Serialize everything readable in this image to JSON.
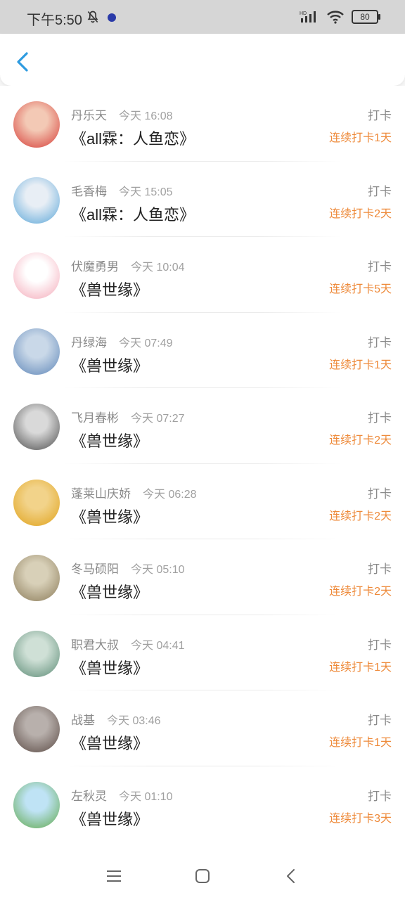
{
  "status_bar": {
    "time": "下午5:50",
    "battery": "80",
    "hd": "HD"
  },
  "header": {
    "back_icon": "chevron-left-icon"
  },
  "records": [
    {
      "name": "丹乐天",
      "time": "今天 16:08",
      "book": "《all霖：人鱼恋》",
      "action": "打卡",
      "streak": "连续打卡1天",
      "avatar_colors": [
        "#d63b36",
        "#f3c9b5"
      ]
    },
    {
      "name": "毛香梅",
      "time": "今天 15:05",
      "book": "《all霖：人鱼恋》",
      "action": "打卡",
      "streak": "连续打卡2天",
      "avatar_colors": [
        "#5aa6d8",
        "#e8eef5"
      ]
    },
    {
      "name": "伏魔勇男",
      "time": "今天 10:04",
      "book": "《兽世缘》",
      "action": "打卡",
      "streak": "连续打卡5天",
      "avatar_colors": [
        "#f4a9b8",
        "#ffffff"
      ]
    },
    {
      "name": "丹绿海",
      "time": "今天 07:49",
      "book": "《兽世缘》",
      "action": "打卡",
      "streak": "连续打卡1天",
      "avatar_colors": [
        "#5e86b8",
        "#c9d8e8"
      ]
    },
    {
      "name": "飞月春彬",
      "time": "今天 07:27",
      "book": "《兽世缘》",
      "action": "打卡",
      "streak": "连续打卡2天",
      "avatar_colors": [
        "#4b4b4b",
        "#d9d9d9"
      ]
    },
    {
      "name": "蓬莱山庆娇",
      "time": "今天 06:28",
      "book": "《兽世缘》",
      "action": "打卡",
      "streak": "连续打卡2天",
      "avatar_colors": [
        "#e0a21a",
        "#f2d38a"
      ]
    },
    {
      "name": "冬马硕阳",
      "time": "今天 05:10",
      "book": "《兽世缘》",
      "action": "打卡",
      "streak": "连续打卡2天",
      "avatar_colors": [
        "#8a7a58",
        "#d8d0b8"
      ]
    },
    {
      "name": "职君大叔",
      "time": "今天 04:41",
      "book": "《兽世缘》",
      "action": "打卡",
      "streak": "连续打卡1天",
      "avatar_colors": [
        "#5a8a74",
        "#cfe0d6"
      ]
    },
    {
      "name": "战基",
      "time": "今天 03:46",
      "book": "《兽世缘》",
      "action": "打卡",
      "streak": "连续打卡1天",
      "avatar_colors": [
        "#5a4a44",
        "#b8b0ac"
      ]
    },
    {
      "name": "左秋灵",
      "time": "今天 01:10",
      "book": "《兽世缘》",
      "action": "打卡",
      "streak": "连续打卡3天",
      "avatar_colors": [
        "#5fa84a",
        "#bfe3f5"
      ]
    }
  ],
  "nav": {
    "menu_icon": "menu-icon",
    "home_icon": "home-square-icon",
    "back_icon": "back-triangle-icon"
  }
}
